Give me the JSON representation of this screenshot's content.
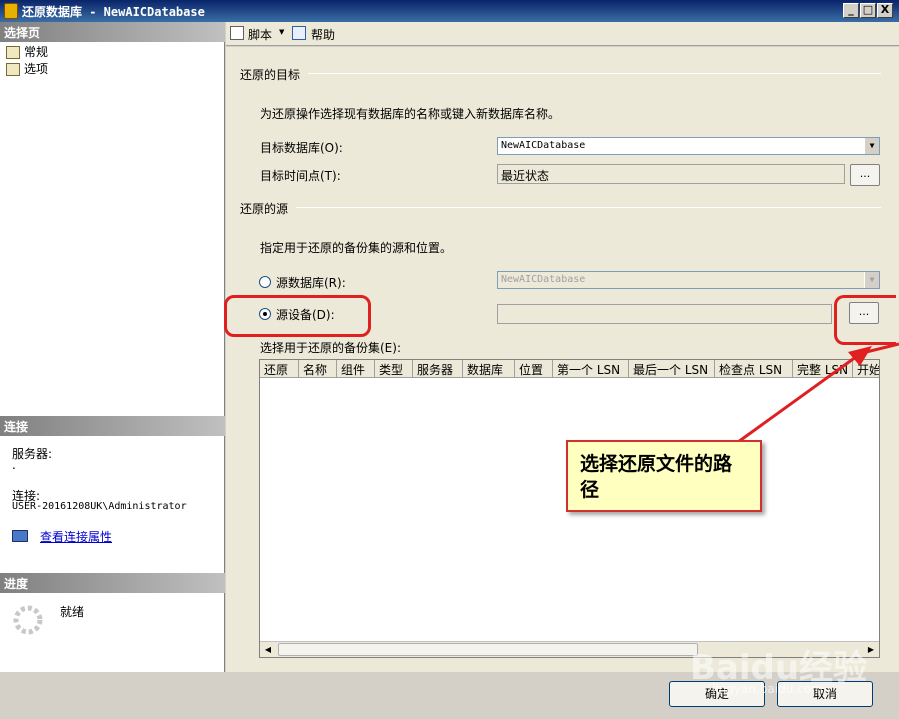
{
  "window": {
    "title": "还原数据库 - NewAICDatabase",
    "buttons": [
      "_",
      "□",
      "X"
    ]
  },
  "left": {
    "select_page_header": "选择页",
    "pages": [
      {
        "label": "常规",
        "icon": "page-icon"
      },
      {
        "label": "选项",
        "icon": "page-icon"
      }
    ],
    "connection_header": "连接",
    "server_label": "服务器:",
    "server_value": ".",
    "connection_label": "连接:",
    "connection_value": "USER-20161208UK\\Administrator",
    "view_connection_link": "查看连接属性",
    "progress_header": "进度",
    "progress_status": "就绪"
  },
  "toolbar": {
    "script_label": "脚本",
    "script_dropdown": "▼",
    "help_label": "帮助"
  },
  "destination": {
    "group_label": "还原的目标",
    "description": "为还原操作选择现有数据库的名称或键入新数据库名称。",
    "target_db_label": "目标数据库(O):",
    "target_db_value": "NewAICDatabase",
    "target_time_label": "目标时间点(T):",
    "target_time_value": "最近状态",
    "ellipsis": "..."
  },
  "source": {
    "group_label": "还原的源",
    "description": "指定用于还原的备份集的源和位置。",
    "source_db_label": "源数据库(R):",
    "source_db_value": "NewAICDatabase",
    "source_device_label": "源设备(D):",
    "source_device_value": "",
    "ellipsis": "...",
    "selected": "source_device"
  },
  "backup_sets": {
    "label": "选择用于还原的备份集(E):",
    "columns": [
      "还原",
      "名称",
      "组件",
      "类型",
      "服务器",
      "数据库",
      "位置",
      "第一个 LSN",
      "最后一个 LSN",
      "检查点 LSN",
      "完整 LSN",
      "开始"
    ],
    "rows": []
  },
  "footer": {
    "ok_label": "确定",
    "cancel_label": "取消"
  },
  "annotation": {
    "callout_text": "选择还原文件的路径",
    "color": "#e02020"
  },
  "watermark": {
    "text": "Baidu经验",
    "url": "jingyan.baidu.com"
  },
  "colors": {
    "titlebar": "#0a246a",
    "panel": "#ece9d8",
    "section_header": "#808080",
    "link": "#0000cc"
  }
}
